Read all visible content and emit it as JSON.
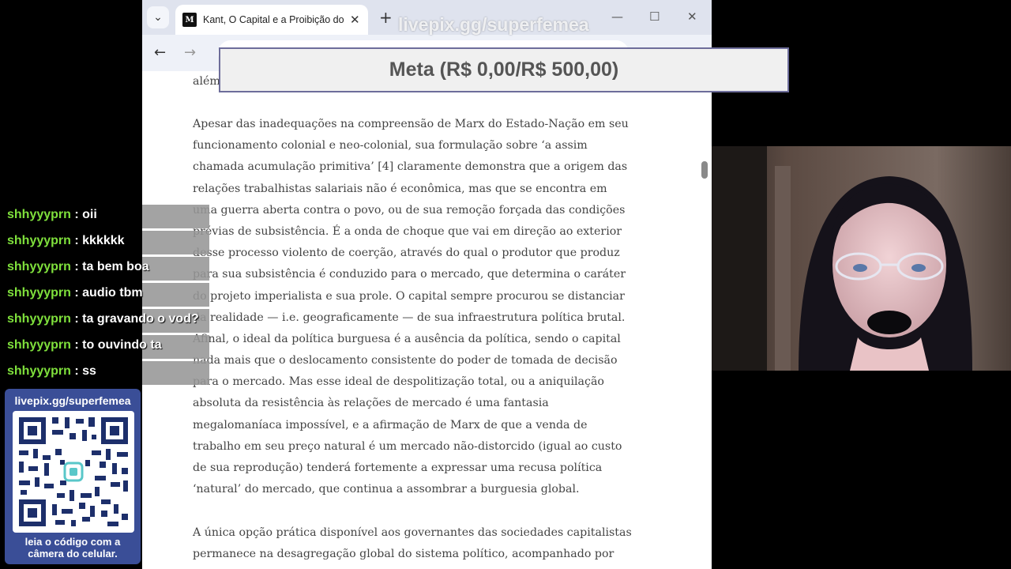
{
  "browser": {
    "tab_title": "Kant, O Capital e a Proibição do Incesto",
    "favicon_text": "M",
    "icons": [
      "tab-search-icon",
      "close-icon",
      "plus-icon",
      "minimize-icon",
      "maximize-icon",
      "close-window-icon",
      "back-arrow-icon",
      "forward-arrow-icon"
    ]
  },
  "article": {
    "top_fragment": "além",
    "paragraph1": [
      "Apesar das inadequações na compreensão de Marx do Estado-Nação em seu",
      "funcionamento colonial e neo-colonial, sua formulação sobre ‘a assim",
      "chamada acumulação primitiva’ [4] claramente demonstra que a origem das",
      "relações trabalhistas salariais não é econômica, mas que se encontra em",
      "uma guerra aberta contra o povo, ou de sua remoção forçada das condições",
      "prévias de subsistência. É a onda de choque que vai em direção ao exterior",
      "desse processo violento de coerção, através do qual o produtor que produz",
      "para sua subsistência é conduzido para o mercado, que determina o caráter",
      "do projeto imperialista e sua prole. O capital sempre procurou se distanciar",
      "da realidade — i.e. geograficamente — de sua infraestrutura política brutal.",
      "Afinal, o ideal da política burguesa é a ausência da política, sendo o capital",
      "nada mais que o deslocamento consistente do poder de tomada de decisão",
      "para o mercado. Mas esse ideal de despolitização total, ou a aniquilação",
      "absoluta da resistência às relações de mercado é uma fantasia",
      "megalomaníaca impossível, e a afirmação de Marx de que a venda de",
      "trabalho em seu preço natural é um mercado não-distorcido (igual ao custo",
      "de sua reprodução) tenderá fortemente a expressar uma recusa política",
      "‘natural’ do mercado, que continua a assombrar a burguesia global."
    ],
    "paragraph2": [
      "A única opção prática disponível aos governantes das sociedades capitalistas",
      "permanece na desagregação global do sistema político, acompanhado por"
    ]
  },
  "overlay": {
    "goal_text": "Meta (R$ 0,00/R$ 500,00)",
    "watermark": "livepix.gg/superfemea"
  },
  "chat": {
    "separator": ":",
    "messages": [
      {
        "user": "shhyyyprn",
        "text": "oii"
      },
      {
        "user": "shhyyyprn",
        "text": "kkkkkk"
      },
      {
        "user": "shhyyyprn",
        "text": "ta bem boa"
      },
      {
        "user": "shhyyyprn",
        "text": "audio tbm"
      },
      {
        "user": "shhyyyprn",
        "text": "ta gravando o vod?"
      },
      {
        "user": "shhyyyprn",
        "text": "to ouvindo ta"
      },
      {
        "user": "shhyyyprn",
        "text": "ss"
      }
    ]
  },
  "qr": {
    "url": "livepix.gg/superfemea",
    "caption_line1": "leia o código com a",
    "caption_line2": "câmera do celular."
  },
  "colors": {
    "chat_username": "#7fe03c",
    "qr_card": "#3a4e97",
    "goal_border": "#6d6d9a"
  }
}
